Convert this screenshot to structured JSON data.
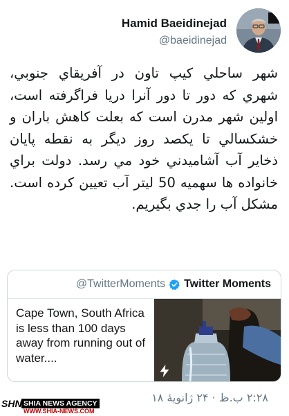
{
  "user": {
    "display_name": "Hamid Baeidinejad",
    "handle": "@baeidinejad"
  },
  "tweet": {
    "text": "شهر ساحلي كيپ تاون در آفريقاي جنوبي، شهري كه دور تا دور آنرا دريا فراگرفته است، اولين شهر مدرن است كه بعلت كاهش باران و خشكسالي تا يكصد روز ديگر به نقطه پايان ذخاير آب آشاميدني خود مي رسد. دولت براي خانواده ها سهميه 50 ليتر آب تعيين كرده است. مشكل آب را جدي بگيريم.",
    "timestamp": "۲:۲۸ ب.ظ · ۲۴ ژانویهٔ ۱۸"
  },
  "card": {
    "source_handle": "@TwitterMoments",
    "source_name": "Twitter Moments",
    "text": "Cape Town, South Africa is less than 100 days away from running out of water....",
    "icons": [
      "verified-badge-icon",
      "lightning-bolt-icon"
    ]
  },
  "watermark": {
    "logo": "SHN",
    "agency": "SHIA NEWS AGENCY",
    "url": "WWW.SHIA-NEWS.COM"
  },
  "colors": {
    "verified_blue": "#1da1f2",
    "secondary_text": "#657786",
    "border": "#ccd6dd"
  }
}
